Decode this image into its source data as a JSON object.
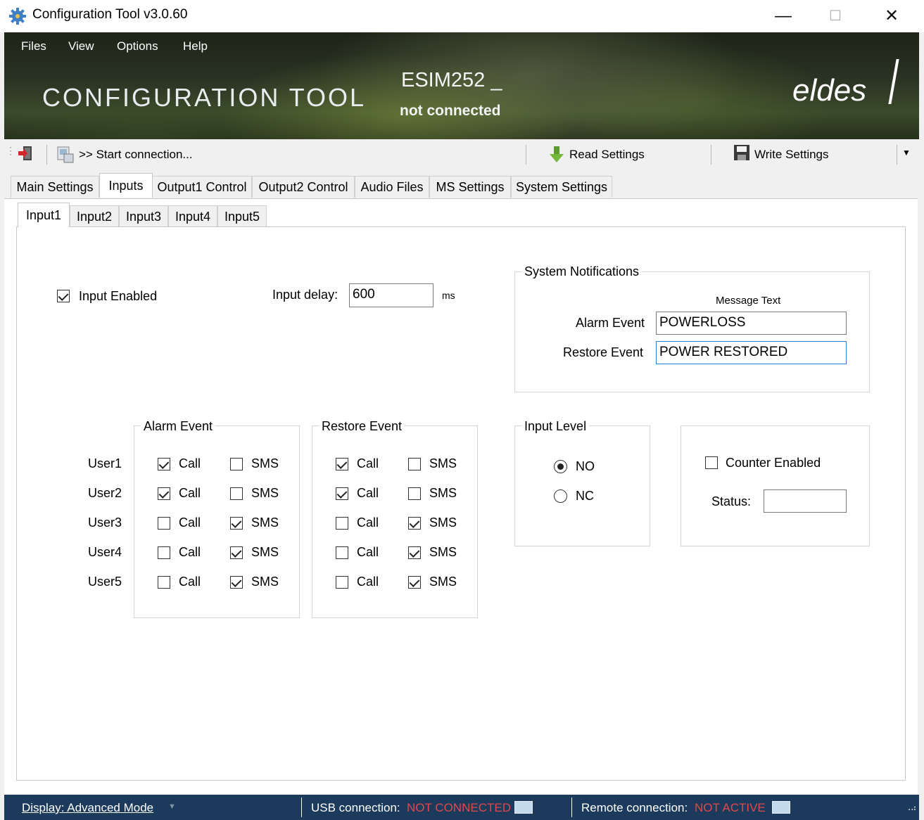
{
  "window": {
    "title": "Configuration Tool v3.0.60",
    "controls": {
      "minimize": "—",
      "maximize": "☐",
      "close": "✕"
    }
  },
  "menu": [
    "Files",
    "View",
    "Options",
    "Help"
  ],
  "banner": {
    "app_title": "CONFIGURATION TOOL",
    "device": "ESIM252",
    "device_suffix": "_",
    "connection_status": "not connected",
    "logo": "eldes"
  },
  "toolbar": {
    "start_connection": ">> Start connection...",
    "read_settings": "Read Settings",
    "write_settings": "Write Settings"
  },
  "main_tabs": [
    {
      "label": "Main Settings",
      "active": false
    },
    {
      "label": "Inputs",
      "active": true
    },
    {
      "label": "Output1 Control",
      "active": false
    },
    {
      "label": "Output2 Control",
      "active": false
    },
    {
      "label": "Audio Files",
      "active": false
    },
    {
      "label": "MS Settings",
      "active": false
    },
    {
      "label": "System Settings",
      "active": false
    }
  ],
  "input_tabs": [
    {
      "label": "Input1",
      "active": true
    },
    {
      "label": "Input2",
      "active": false
    },
    {
      "label": "Input3",
      "active": false
    },
    {
      "label": "Input4",
      "active": false
    },
    {
      "label": "Input5",
      "active": false
    }
  ],
  "input": {
    "enabled_label": "Input Enabled",
    "enabled": true,
    "delay_label": "Input delay:",
    "delay_value": "600",
    "delay_unit": "ms"
  },
  "notifications": {
    "group_title": "System Notifications",
    "column_header": "Message Text",
    "alarm_label": "Alarm Event",
    "alarm_text": "POWERLOSS",
    "restore_label": "Restore Event",
    "restore_text": "POWER RESTORED"
  },
  "events": {
    "alarm_title": "Alarm Event",
    "restore_title": "Restore Event",
    "call_label": "Call",
    "sms_label": "SMS",
    "users": [
      {
        "name": "User1",
        "alarm_call": true,
        "alarm_sms": false,
        "restore_call": true,
        "restore_sms": false
      },
      {
        "name": "User2",
        "alarm_call": true,
        "alarm_sms": false,
        "restore_call": true,
        "restore_sms": false
      },
      {
        "name": "User3",
        "alarm_call": false,
        "alarm_sms": true,
        "restore_call": false,
        "restore_sms": true
      },
      {
        "name": "User4",
        "alarm_call": false,
        "alarm_sms": true,
        "restore_call": false,
        "restore_sms": true
      },
      {
        "name": "User5",
        "alarm_call": false,
        "alarm_sms": true,
        "restore_call": false,
        "restore_sms": true
      }
    ]
  },
  "input_level": {
    "title": "Input Level",
    "options": [
      {
        "label": "NO",
        "selected": true
      },
      {
        "label": "NC",
        "selected": false
      }
    ]
  },
  "counter": {
    "enabled_label": "Counter Enabled",
    "enabled": false,
    "status_label": "Status:",
    "status_value": ""
  },
  "statusbar": {
    "display_mode": "Display: Advanced Mode",
    "usb_label": "USB connection:",
    "usb_status": "NOT CONNECTED",
    "remote_label": "Remote connection:",
    "remote_status": "NOT ACTIVE"
  },
  "colors": {
    "status_bar_bg": "#1c3b5c",
    "status_alert": "#e0474d",
    "focus_border": "#2f7fd4"
  }
}
